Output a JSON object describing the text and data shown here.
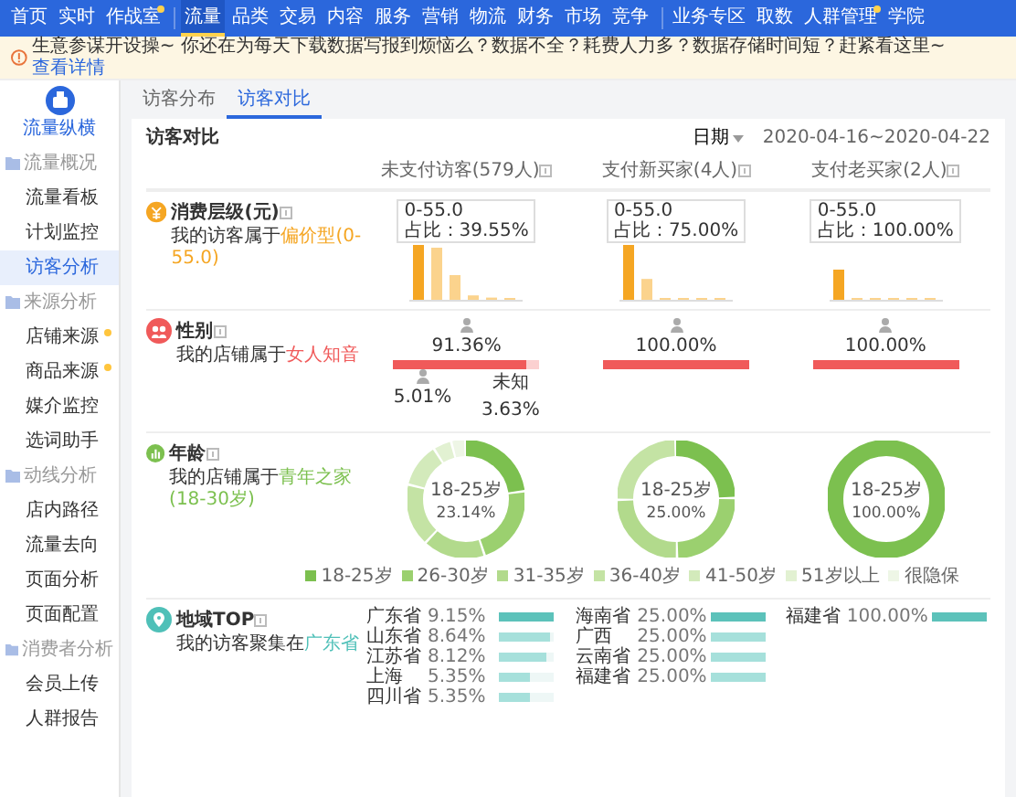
{
  "nav": {
    "groups": [
      [
        {
          "label": "首页",
          "selected": false,
          "dot": false
        },
        {
          "label": "实时",
          "selected": false,
          "dot": false
        },
        {
          "label": "作战室",
          "selected": false,
          "dot": true
        }
      ],
      [
        {
          "label": "流量",
          "selected": true,
          "dot": false
        },
        {
          "label": "品类",
          "selected": false,
          "dot": false
        },
        {
          "label": "交易",
          "selected": false,
          "dot": false
        },
        {
          "label": "内容",
          "selected": false,
          "dot": false
        },
        {
          "label": "服务",
          "selected": false,
          "dot": false
        },
        {
          "label": "营销",
          "selected": false,
          "dot": false
        },
        {
          "label": "物流",
          "selected": false,
          "dot": false
        },
        {
          "label": "财务",
          "selected": false,
          "dot": false
        },
        {
          "label": "市场",
          "selected": false,
          "dot": false
        },
        {
          "label": "竞争",
          "selected": false,
          "dot": false
        }
      ],
      [
        {
          "label": "业务专区",
          "selected": false,
          "dot": false
        },
        {
          "label": "取数",
          "selected": false,
          "dot": false
        },
        {
          "label": "人群管理",
          "selected": false,
          "dot": true
        },
        {
          "label": "学院",
          "selected": false,
          "dot": false
        }
      ]
    ]
  },
  "notice": {
    "text": "生意参谋开设操~ 你还在为每天下载数据写报到烦恼么？数据不全？耗费人力多？数据存储时间短？赶紧看这里~",
    "link": "查看详情"
  },
  "sidebar": {
    "title": "流量纵横",
    "groups": [
      {
        "label": "流量概况",
        "items": [
          {
            "label": "流量看板",
            "selected": false,
            "dot": false
          },
          {
            "label": "计划监控",
            "selected": false,
            "dot": false
          },
          {
            "label": "访客分析",
            "selected": true,
            "dot": false
          }
        ]
      },
      {
        "label": "来源分析",
        "items": [
          {
            "label": "店铺来源",
            "selected": false,
            "dot": true
          },
          {
            "label": "商品来源",
            "selected": false,
            "dot": true
          },
          {
            "label": "媒介监控",
            "selected": false,
            "dot": false
          },
          {
            "label": "选词助手",
            "selected": false,
            "dot": false
          }
        ]
      },
      {
        "label": "动线分析",
        "items": [
          {
            "label": "店内路径",
            "selected": false,
            "dot": false
          },
          {
            "label": "流量去向",
            "selected": false,
            "dot": false
          },
          {
            "label": "页面分析",
            "selected": false,
            "dot": false
          },
          {
            "label": "页面配置",
            "selected": false,
            "dot": false
          }
        ]
      },
      {
        "label": "消费者分析",
        "items": [
          {
            "label": "会员上传",
            "selected": false,
            "dot": false
          },
          {
            "label": "人群报告",
            "selected": false,
            "dot": false
          }
        ]
      }
    ]
  },
  "tabs": [
    {
      "label": "访客分布",
      "selected": false
    },
    {
      "label": "访客对比",
      "selected": true
    }
  ],
  "panel": {
    "title": "访客对比",
    "date_label": "日期",
    "date_range": "2020-04-16~2020-04-22",
    "columns": [
      "未支付访客(579人)",
      "支付新买家(4人)",
      "支付老买家(2人)"
    ]
  },
  "price": {
    "title": "消费层级(元)",
    "prefix": "我的访客属于",
    "highlight": "偏价型(0-55.0)",
    "tooltips": [
      {
        "range": "0-55.0",
        "share": "占比：39.55%"
      },
      {
        "range": "0-55.0",
        "share": "占比：75.00%"
      },
      {
        "range": "0-55.0",
        "share": "占比：100.00%"
      }
    ]
  },
  "gender": {
    "title": "性别",
    "prefix": "我的店铺属于",
    "highlight": "女人知音",
    "columns": [
      {
        "percent": "91.36%",
        "level": 0.9136,
        "others": [
          {
            "kind": "male",
            "percent": "5.01%"
          },
          {
            "kind": "unknown",
            "label": "未知",
            "percent": "3.63%"
          }
        ]
      },
      {
        "percent": "100.00%",
        "level": 1
      },
      {
        "percent": "100.00%",
        "level": 1
      }
    ]
  },
  "age": {
    "title": "年龄",
    "prefix": "我的店铺属于",
    "highlight": "青年之家(18-30岁)",
    "donuts": [
      {
        "label": "18-25岁",
        "percent": "23.14%"
      },
      {
        "label": "18-25岁",
        "percent": "25.00%"
      },
      {
        "label": "18-25岁",
        "percent": "100.00%"
      }
    ],
    "legend": [
      {
        "label": "18-25岁",
        "color": "#7cc04f"
      },
      {
        "label": "26-30岁",
        "color": "#9bd06f"
      },
      {
        "label": "31-35岁",
        "color": "#b2da8c"
      },
      {
        "label": "36-40岁",
        "color": "#c4e3a4"
      },
      {
        "label": "41-50岁",
        "color": "#d3eabb"
      },
      {
        "label": "51岁以上",
        "color": "#e2f1d2"
      },
      {
        "label": "很隐保",
        "color": "#eef6e6"
      }
    ]
  },
  "region": {
    "title": "地域TOP",
    "prefix": "我的访客聚集在",
    "highlight": "广东省",
    "columns": [
      [
        {
          "name": "广东省",
          "percent": "9.15%",
          "level": 1
        },
        {
          "name": "山东省",
          "percent": "8.64%",
          "level": 0.94
        },
        {
          "name": "江苏省",
          "percent": "8.12%",
          "level": 0.88
        },
        {
          "name": "上海",
          "percent": "5.35%",
          "level": 0.58
        },
        {
          "name": "四川省",
          "percent": "5.35%",
          "level": 0.58
        }
      ],
      [
        {
          "name": "海南省",
          "percent": "25.00%",
          "level": 1
        },
        {
          "name": "广西",
          "percent": "25.00%",
          "level": 1
        },
        {
          "name": "云南省",
          "percent": "25.00%",
          "level": 1
        },
        {
          "name": "福建省",
          "percent": "25.00%",
          "level": 1
        }
      ],
      [
        {
          "name": "福建省",
          "percent": "100.00%",
          "level": 1
        }
      ]
    ]
  }
}
